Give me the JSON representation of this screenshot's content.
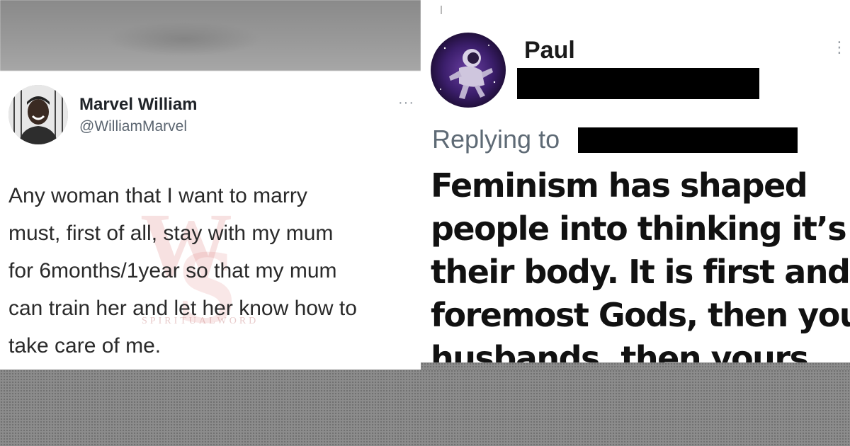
{
  "left_tweet": {
    "name": "Marvel William",
    "handle": "@WilliamMarvel",
    "more": "···",
    "body_lines": [
      "Any woman that I want to marry",
      "must, first of all, stay with my mum",
      "for 6months/1year so that my mum",
      "can train her and let her know how to",
      "take care of me."
    ],
    "watermark_text": "SPIRITUALWORD",
    "avatar": "user-avatar-photo"
  },
  "right_tweet": {
    "name": "Paul",
    "replying_label": "Replying to",
    "body_lines": [
      "Feminism has shaped",
      "people into thinking it’s",
      "their body. It is first and",
      "foremost Gods, then your",
      "husbands, then yours."
    ],
    "avatar": "astronaut-avatar",
    "more": "⋮"
  },
  "colors": {
    "redaction": "#000000",
    "watermark": "#e3a8a8",
    "band": "#8c8c8c"
  }
}
